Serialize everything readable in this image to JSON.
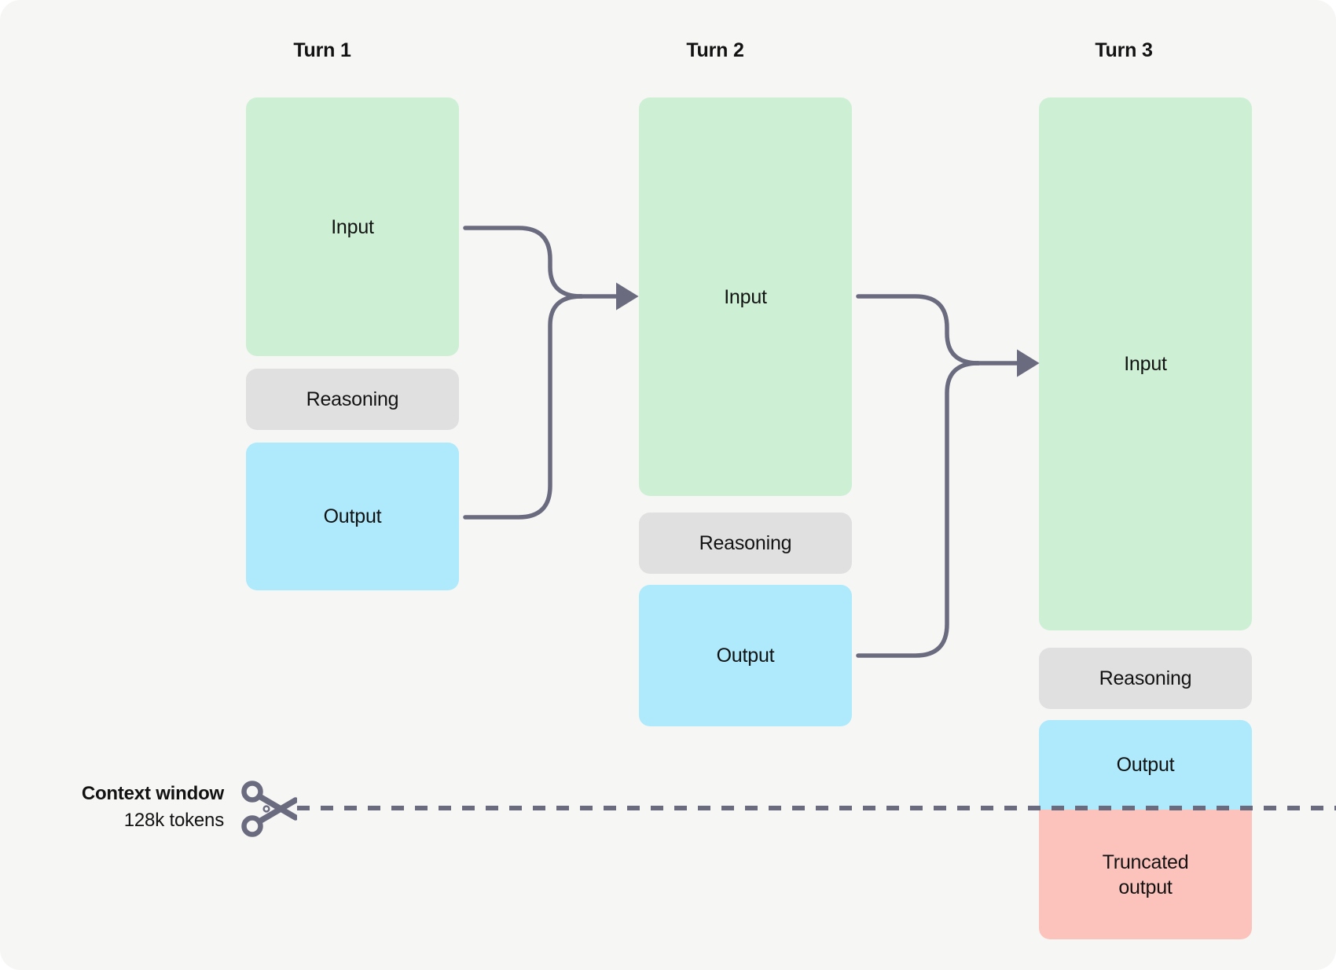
{
  "diagram": {
    "title_hidden": "Context window truncation across conversation turns",
    "accent_line_color": "#6b6b80",
    "background_color": "#f6f6f5",
    "colors": {
      "input": "#cdf0d4",
      "reasoning": "#e0e0e0",
      "output": "#aeeafb",
      "truncated": "#fcc3bd",
      "connector": "#6b6b80",
      "text": "#121212"
    },
    "columns": [
      {
        "id": "turn-1",
        "title": "Turn 1",
        "blocks": [
          {
            "type": "input",
            "label": "Input"
          },
          {
            "type": "reasoning",
            "label": "Reasoning"
          },
          {
            "type": "output",
            "label": "Output"
          }
        ]
      },
      {
        "id": "turn-2",
        "title": "Turn 2",
        "blocks": [
          {
            "type": "input",
            "label": "Input"
          },
          {
            "type": "reasoning",
            "label": "Reasoning"
          },
          {
            "type": "output",
            "label": "Output"
          }
        ]
      },
      {
        "id": "turn-3",
        "title": "Turn 3",
        "blocks": [
          {
            "type": "input",
            "label": "Input"
          },
          {
            "type": "reasoning",
            "label": "Reasoning"
          },
          {
            "type": "output",
            "label": "Output"
          },
          {
            "type": "truncated",
            "label": "Truncated\noutput"
          }
        ]
      }
    ],
    "context_window": {
      "title": "Context window",
      "subtitle": "128k tokens",
      "icon": "scissors-icon",
      "line_style": "dashed"
    },
    "arrows": [
      {
        "from": "turn-1",
        "to": "turn-2",
        "icon": "arrow-right-icon"
      },
      {
        "from": "turn-2",
        "to": "turn-3",
        "icon": "arrow-right-icon"
      }
    ]
  },
  "labels": {
    "turn1_title": "Turn 1",
    "turn2_title": "Turn 2",
    "turn3_title": "Turn 3",
    "t1_input": "Input",
    "t1_reasoning": "Reasoning",
    "t1_output": "Output",
    "t2_input": "Input",
    "t2_reasoning": "Reasoning",
    "t2_output": "Output",
    "t3_input": "Input",
    "t3_reasoning": "Reasoning",
    "t3_output": "Output",
    "t3_truncated_line1": "Truncated",
    "t3_truncated_line2": "output",
    "ctx_title": "Context window",
    "ctx_subtitle": "128k tokens"
  }
}
